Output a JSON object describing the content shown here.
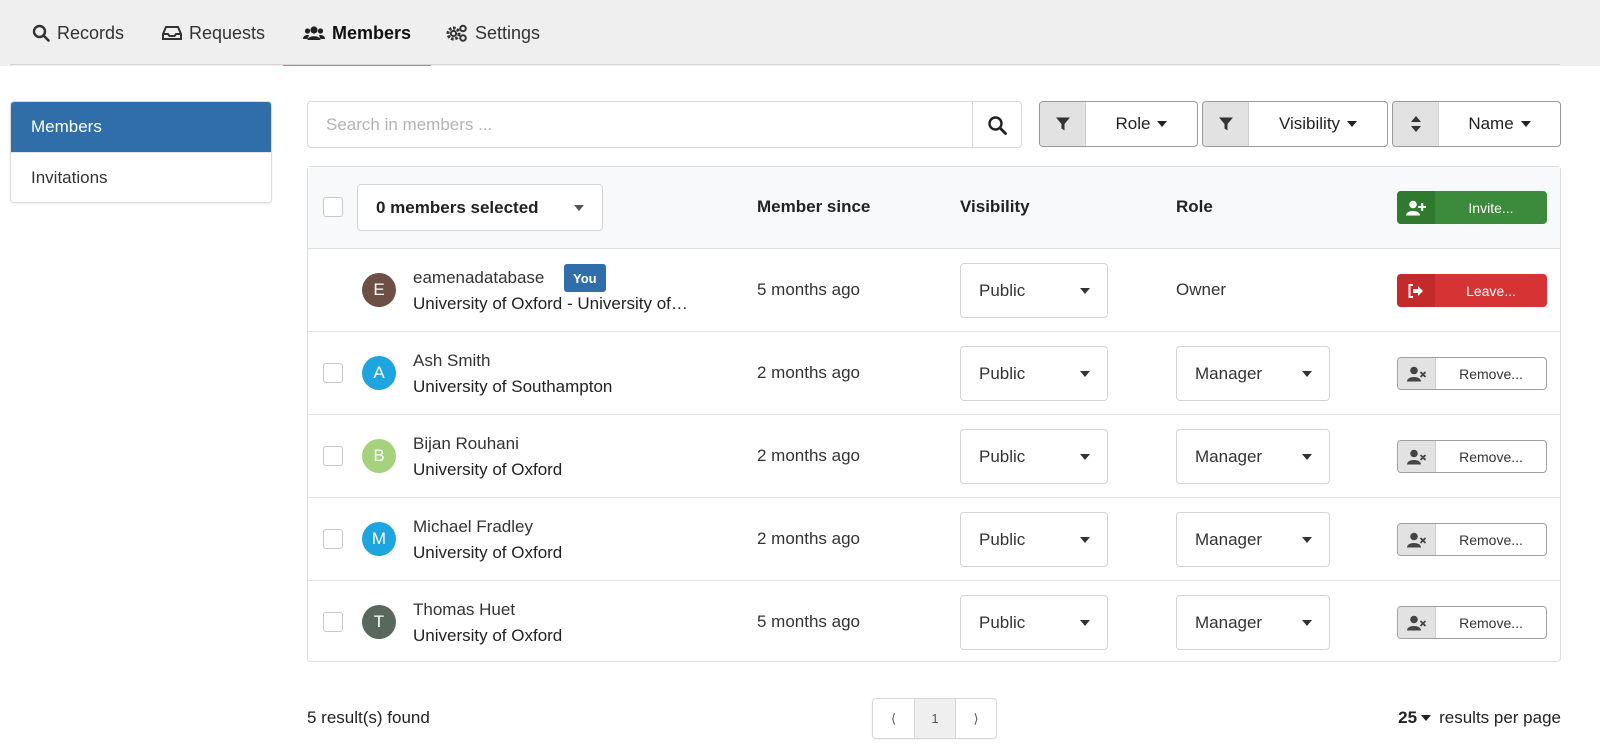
{
  "tabs": [
    {
      "label": "Records",
      "icon": "search-icon"
    },
    {
      "label": "Requests",
      "icon": "inbox-icon"
    },
    {
      "label": "Members",
      "icon": "users-icon",
      "active": true
    },
    {
      "label": "Settings",
      "icon": "gears-icon"
    }
  ],
  "sidebar": {
    "items": [
      {
        "label": "Members",
        "active": true
      },
      {
        "label": "Invitations"
      }
    ]
  },
  "search": {
    "placeholder": "Search in members ..."
  },
  "filters": {
    "role": "Role",
    "visibility": "Visibility",
    "sort": "Name"
  },
  "table": {
    "selected_label": "0 members selected",
    "columns": {
      "member_since": "Member since",
      "visibility": "Visibility",
      "role": "Role"
    },
    "invite_label": "Invite...",
    "rows": [
      {
        "initial": "E",
        "avatar_color": "#6e4f45",
        "name": "eamenadatabase",
        "badge": "You",
        "affiliation": "University of Oxford - University of…",
        "since": "5 months ago",
        "visibility": "Public",
        "role": "Owner",
        "action": "Leave..."
      },
      {
        "initial": "A",
        "avatar_color": "#1ea5df",
        "name": "Ash Smith",
        "affiliation": "University of Southampton",
        "since": "2 months ago",
        "visibility": "Public",
        "role": "Manager",
        "action": "Remove..."
      },
      {
        "initial": "B",
        "avatar_color": "#a6d17d",
        "name": "Bijan Rouhani",
        "affiliation": "University of Oxford",
        "since": "2 months ago",
        "visibility": "Public",
        "role": "Manager",
        "action": "Remove..."
      },
      {
        "initial": "M",
        "avatar_color": "#1ea5df",
        "name": "Michael Fradley",
        "affiliation": "University of Oxford",
        "since": "2 months ago",
        "visibility": "Public",
        "role": "Manager",
        "action": "Remove..."
      },
      {
        "initial": "T",
        "avatar_color": "#58685c",
        "name": "Thomas Huet",
        "affiliation": "University of Oxford",
        "since": "5 months ago",
        "visibility": "Public",
        "role": "Manager",
        "action": "Remove..."
      }
    ]
  },
  "footer": {
    "results": "5 result(s) found",
    "pager": {
      "prev": "⟨",
      "page": "1",
      "next": "⟩"
    },
    "per_page_value": "25",
    "per_page_label": "results per page"
  },
  "colors": {
    "primary": "#2f6ea8",
    "success": "#3c8a3c",
    "danger": "#d63434",
    "tab_underline": "#e87a6a"
  }
}
